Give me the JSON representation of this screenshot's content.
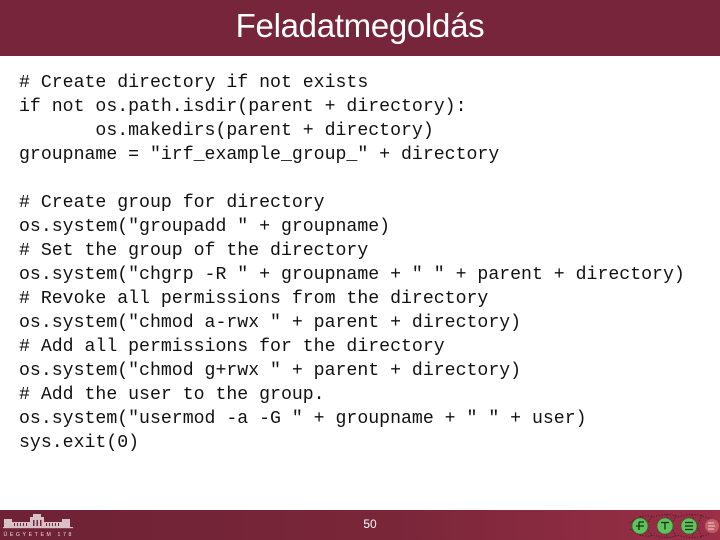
{
  "slide": {
    "title": "Feladatmegoldás",
    "page_number": "50"
  },
  "code": {
    "language": "python",
    "lines": [
      "# Create directory if not exists",
      "if not os.path.isdir(parent + directory):",
      "       os.makedirs(parent + directory)",
      "groupname = \"irf_example_group_\" + directory",
      "",
      "# Create group for directory",
      "os.system(\"groupadd \" + groupname)",
      "# Set the group of the directory",
      "os.system(\"chgrp -R \" + groupname + \" \" + parent + directory)",
      "# Revoke all permissions from the directory",
      "os.system(\"chmod a-rwx \" + parent + directory)",
      "# Add all permissions for the directory",
      "os.system(\"chmod g+rwx \" + parent + directory)",
      "# Add the user to the group.",
      "os.system(\"usermod -a -G \" + groupname + \" \" + user)",
      "sys.exit(0)"
    ]
  },
  "footer": {
    "left_logo": "university-building-logo",
    "left_logo_caption": "MŰEGYETEM 1782",
    "right_logo": "ftsrg-logo",
    "right_logo_letters": [
      "F",
      "T",
      "S",
      "RG"
    ]
  },
  "colors": {
    "brand": "#76253a",
    "title_text": "#ffffff",
    "code_text": "#111111",
    "logo_green": "#5fc25a",
    "logo_red": "#c9656c"
  }
}
